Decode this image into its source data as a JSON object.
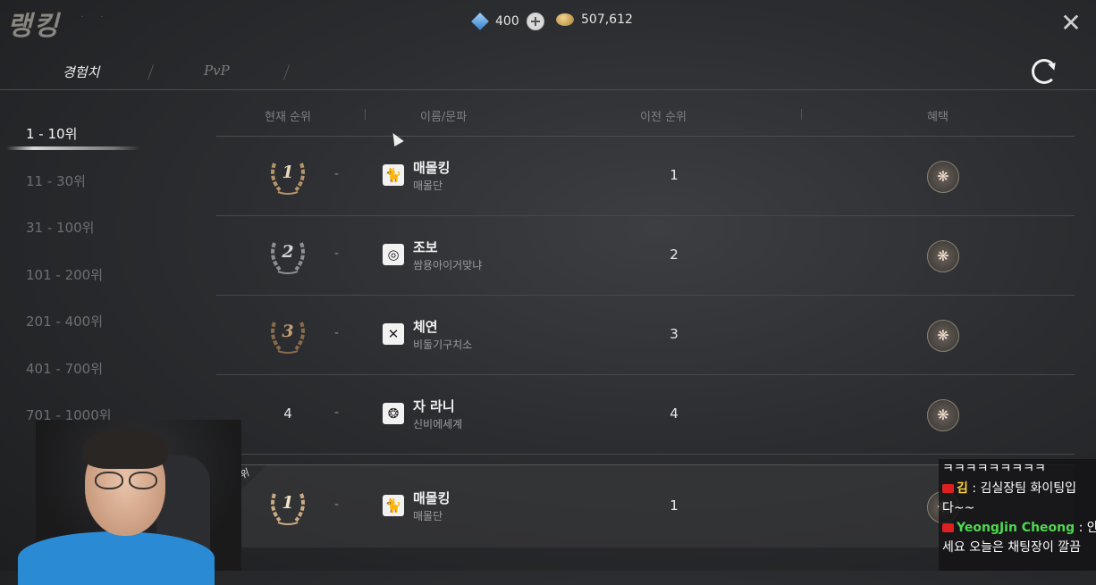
{
  "header": {
    "title": "랭킹",
    "tabs": [
      {
        "label": "경험치",
        "active": true
      },
      {
        "label": "PvP",
        "active": false
      }
    ],
    "currency": {
      "gem_icon": "blue-gem-icon",
      "gem_value": "400",
      "gold_icon": "gold-coin-icon",
      "gold_value": "507,612"
    },
    "close_icon": "close-icon",
    "refresh_icon": "refresh-icon"
  },
  "sidebar": {
    "items": [
      {
        "label": "1 - 10위",
        "active": true
      },
      {
        "label": "11 - 30위",
        "active": false
      },
      {
        "label": "31 - 100위",
        "active": false
      },
      {
        "label": "101 - 200위",
        "active": false
      },
      {
        "label": "201 - 400위",
        "active": false
      },
      {
        "label": "401 - 700위",
        "active": false
      },
      {
        "label": "701 - 1000위",
        "active": false
      }
    ]
  },
  "table": {
    "columns": {
      "current_rank": "현재 순위",
      "name": "이름/문파",
      "previous_rank": "이전 순위",
      "reward": "혜택"
    },
    "rows": [
      {
        "rank": "1",
        "change": "-",
        "emblem": "🐈",
        "name": "매몰킹",
        "guild": "매몰단",
        "previous": "1",
        "medal": "gold"
      },
      {
        "rank": "2",
        "change": "-",
        "emblem": "◎",
        "name": "조보",
        "guild": "쌈용아이거맞냐",
        "previous": "2",
        "medal": "silver"
      },
      {
        "rank": "3",
        "change": "-",
        "emblem": "✕",
        "name": "체연",
        "guild": "비둘기구치소",
        "previous": "3",
        "medal": "bronze"
      },
      {
        "rank": "4",
        "change": "-",
        "emblem": "❂",
        "name": "자 라니",
        "guild": "신비에세계",
        "previous": "4",
        "medal": "none"
      }
    ],
    "my_rank": {
      "badge": "내 순위",
      "rank": "1",
      "change": "-",
      "emblem": "🐈",
      "name": "매몰킹",
      "guild": "매몰단",
      "previous": "1"
    }
  },
  "chat": {
    "lines": [
      {
        "user": "",
        "text": "ㅋㅋㅋㅋㅋㅋㅋㅋㅋ"
      },
      {
        "user": "김",
        "text": ": 김실장팀 화이팅입"
      },
      {
        "user": "",
        "text": "다~~"
      },
      {
        "user": "YeongJin Cheong",
        "text": ": 안"
      },
      {
        "user": "",
        "text": "세요 오늘은 채팅장이 깔끔"
      }
    ]
  }
}
